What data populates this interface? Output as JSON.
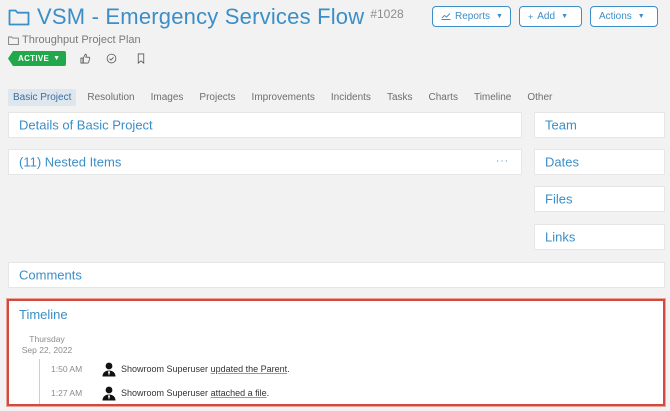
{
  "header": {
    "title": "VSM - Emergency Services Flow",
    "id": "#1028",
    "parent": "Throughput Project Plan",
    "status": "ACTIVE"
  },
  "toolbar": {
    "reports_label": "Reports",
    "add_label": "Add",
    "actions_label": "Actions"
  },
  "tabs": [
    {
      "label": "Basic Project",
      "active": true
    },
    {
      "label": "Resolution"
    },
    {
      "label": "Images"
    },
    {
      "label": "Projects"
    },
    {
      "label": "Improvements"
    },
    {
      "label": "Incidents"
    },
    {
      "label": "Tasks"
    },
    {
      "label": "Charts"
    },
    {
      "label": "Timeline"
    },
    {
      "label": "Other"
    }
  ],
  "main": {
    "details_title": "Details of Basic Project",
    "nested_title": "(11) Nested Items",
    "nested_menu": "···",
    "comments_title": "Comments"
  },
  "sidebar": {
    "team": "Team",
    "dates": "Dates",
    "files": "Files",
    "links": "Links"
  },
  "timeline": {
    "title": "Timeline",
    "day_name": "Thursday",
    "date": "Sep 22, 2022",
    "entries": [
      {
        "time": "1:50 AM",
        "user": "Showroom Superuser",
        "action": "updated the Parent",
        "suffix": "."
      },
      {
        "time": "1:27 AM",
        "user": "Showroom Superuser",
        "action": "attached a file",
        "suffix": "."
      }
    ]
  },
  "colors": {
    "accent": "#3b8ec7",
    "active_badge": "#21a84a",
    "highlight_border": "#d24a3e"
  }
}
